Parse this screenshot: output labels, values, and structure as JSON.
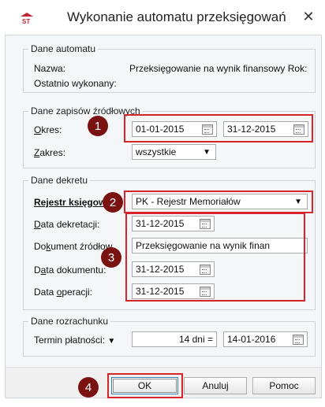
{
  "window": {
    "title": "Wykonanie automatu przeksięgowań",
    "close_glyph": "✕"
  },
  "dane_automatu": {
    "legend": "Dane automatu",
    "nazwa_label": "Nazwa:",
    "nazwa_value": "Przeksięgowanie na wynik finansowy Rok:",
    "ostatnio_label": "Ostatnio wykonany:",
    "ostatnio_value": ""
  },
  "dane_zapisow": {
    "legend": "Dane zapisów źródłowych",
    "okres_label_first": "O",
    "okres_label_rest": "kres:",
    "okres_od": "01-01-2015",
    "okres_do": "31-12-2015",
    "zakres_label_first": "Z",
    "zakres_label_rest": "akres:",
    "zakres_value": "wszystkie"
  },
  "dane_dekretu": {
    "legend": "Dane dekretu",
    "rejestr_label": "Rejestr księgow",
    "rejestr_value": "PK - Rejestr Memoriałów",
    "data_dekretacji_label_first": "D",
    "data_dekretacji_label_rest": "ata dekretacji:",
    "data_dekretacji_value": "31-12-2015",
    "dokument_label_pre": "Do",
    "dokument_label_u": "k",
    "dokument_label_post": "ument źródłow",
    "dokument_value": "Przeksięgowanie na wynik finan",
    "data_dokumentu_label_pre": "D",
    "data_dokumentu_label_u": "a",
    "data_dokumentu_label_post": "ta dokumentu:",
    "data_dokumentu_value": "31-12-2015",
    "data_operacji_label_pre": "Data ",
    "data_operacji_label_u": "o",
    "data_operacji_label_post": "peracji:",
    "data_operacji_value": "31-12-2015"
  },
  "dane_rozrachunku": {
    "legend": "Dane rozrachunku",
    "termin_label": "Termin płatności:",
    "termin_dni": "14 dni =",
    "termin_data": "14-01-2016"
  },
  "buttons": {
    "ok": "OK",
    "anuluj": "Anuluj",
    "pomoc": "Pomoc"
  },
  "badges": [
    "1",
    "2",
    "3",
    "4"
  ],
  "colors": {
    "highlight": "#d6242d",
    "badge": "#7a1212"
  }
}
